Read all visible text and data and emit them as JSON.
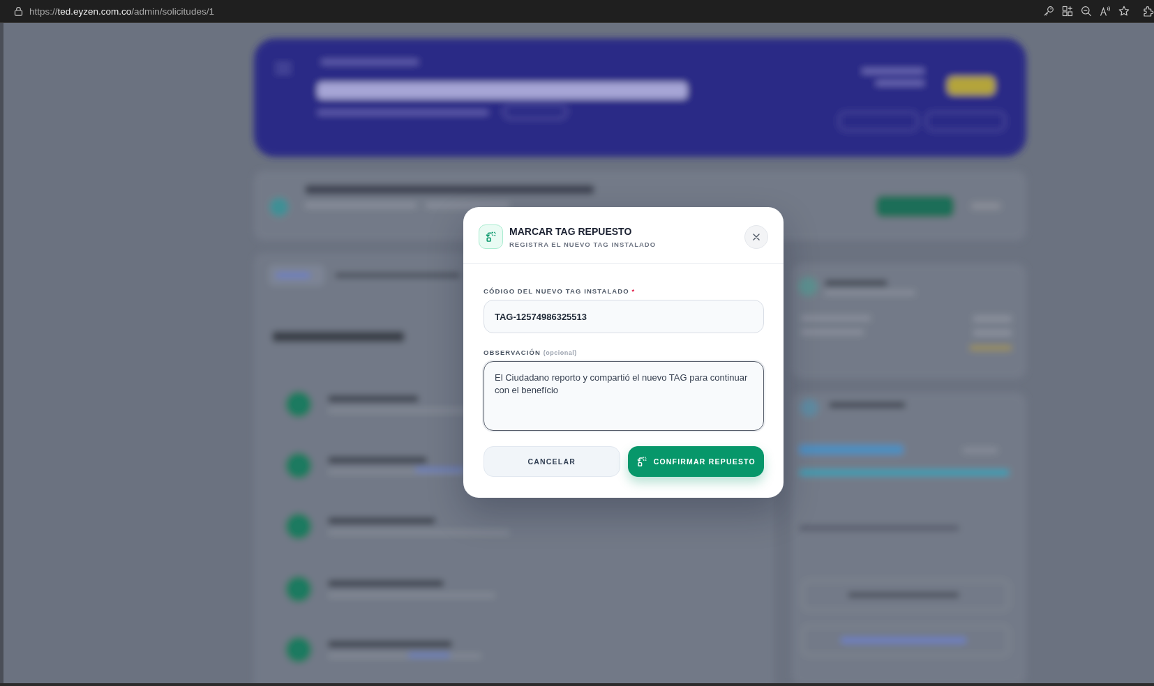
{
  "browser": {
    "url_scheme": "https://",
    "url_host": "ted.eyzen.com.co",
    "url_path": "/admin/solicitudes/1"
  },
  "dialog": {
    "title": "MARCAR TAG REPUESTO",
    "subtitle": "REGISTRA EL NUEVO TAG INSTALADO",
    "fields": [
      {
        "kind": "input",
        "label": "CÓDIGO DEL NUEVO TAG INSTALADO",
        "required_mark": "*",
        "value": "TAG-12574986325513",
        "focused": false
      },
      {
        "kind": "textarea",
        "label": "OBSERVACIÓN",
        "hint": "(opcional)",
        "value": "El Ciudadano reporto y compartió el nuevo TAG para continuar con el benefício",
        "focused": true
      }
    ],
    "buttons": [
      {
        "kind": "cancel",
        "label": "CANCELAR"
      },
      {
        "kind": "confirm",
        "label": "CONFIRMAR REPUESTO"
      }
    ]
  }
}
